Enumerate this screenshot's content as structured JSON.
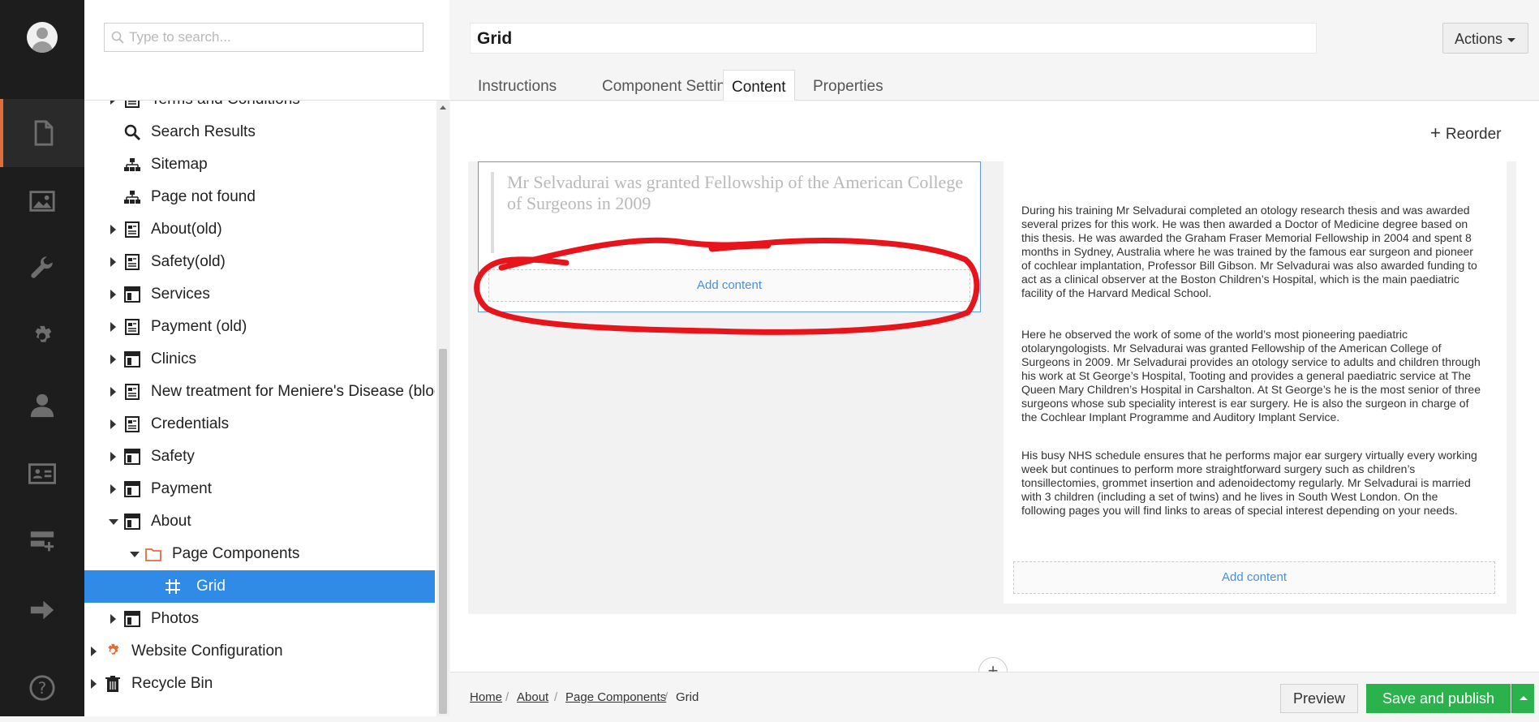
{
  "search": {
    "placeholder": "Type to search..."
  },
  "tree": {
    "items": [
      {
        "label": "Terms and Conditions",
        "icon": "document-icon"
      },
      {
        "label": "Search Results",
        "icon": "search-icon"
      },
      {
        "label": "Sitemap",
        "icon": "sitemap-icon"
      },
      {
        "label": "Page not found",
        "icon": "sitemap-icon"
      },
      {
        "label": "About(old)",
        "icon": "document-icon"
      },
      {
        "label": "Safety(old)",
        "icon": "document-icon"
      },
      {
        "label": "Services",
        "icon": "layout-icon"
      },
      {
        "label": "Payment (old)",
        "icon": "document-icon"
      },
      {
        "label": "Clinics",
        "icon": "layout-icon"
      },
      {
        "label": "New treatment for Meniere's Disease (blog",
        "icon": "document-icon"
      },
      {
        "label": "Credentials",
        "icon": "document-icon"
      },
      {
        "label": "Safety",
        "icon": "layout-icon"
      },
      {
        "label": "Payment",
        "icon": "layout-icon"
      },
      {
        "label": "About",
        "icon": "layout-icon"
      },
      {
        "label": "Page Components",
        "icon": "folder-icon"
      },
      {
        "label": "Grid",
        "icon": "grid-icon"
      },
      {
        "label": "Photos",
        "icon": "layout-icon"
      },
      {
        "label": "Website Configuration",
        "icon": "gear-icon"
      },
      {
        "label": "Recycle Bin",
        "icon": "trash-icon"
      }
    ]
  },
  "header": {
    "title": "Grid",
    "actions_label": "Actions"
  },
  "tabs": [
    "Instructions",
    "Component Settings",
    "Content",
    "Properties"
  ],
  "content": {
    "reorder_label": "Reorder",
    "quote": "Mr Selvadurai was granted Fellowship of the American College of Surgeons in 2009",
    "add_content_label": "Add content",
    "paragraphs": [
      "During his training Mr Selvadurai completed an otology research thesis and was awarded several prizes for this work. He was then awarded a Doctor of Medicine degree based on this thesis. He was awarded the Graham Fraser Memorial Fellowship in 2004 and spent 8 months in Sydney, Australia where he was trained by the famous ear surgeon and pioneer of cochlear implantation, Professor Bill Gibson. Mr Selvadurai was also awarded funding to act as a clinical observer at the Boston Children’s Hospital, which is the main paediatric facility of the Harvard Medical School.",
      "Here he observed the work of some of the world’s most pioneering paediatric otolaryngologists. Mr Selvadurai was granted Fellowship of the American College of Surgeons in 2009. Mr Selvadurai provides an otology service to adults and children through his work at St George’s Hospital, Tooting and provides a general paediatric service at The Queen Mary Children’s Hospital in Carshalton. At St George’s he is the most senior of three surgeons whose sub speciality interest is ear surgery. He is also the surgeon in charge of the Cochlear Implant Programme and Auditory Implant Service.",
      "His busy NHS schedule ensures that he performs major ear surgery virtually every working week but continues to perform more straightforward surgery such as children’s tonsillectomies, grommet insertion and adenoidectomy regularly. Mr Selvadurai is married with 3 children (including a set of twins) and he lives in South West London. On the following pages you will find links to areas of special interest depending on your needs."
    ]
  },
  "breadcrumb": [
    "Home",
    "About",
    "Page Components",
    "Grid"
  ],
  "footer": {
    "preview_label": "Preview",
    "save_label": "Save and publish"
  },
  "colors": {
    "accent": "#2f8be6",
    "save": "#2bb24c",
    "annotation": "#e8141c",
    "active_section": "#e06d3c"
  }
}
